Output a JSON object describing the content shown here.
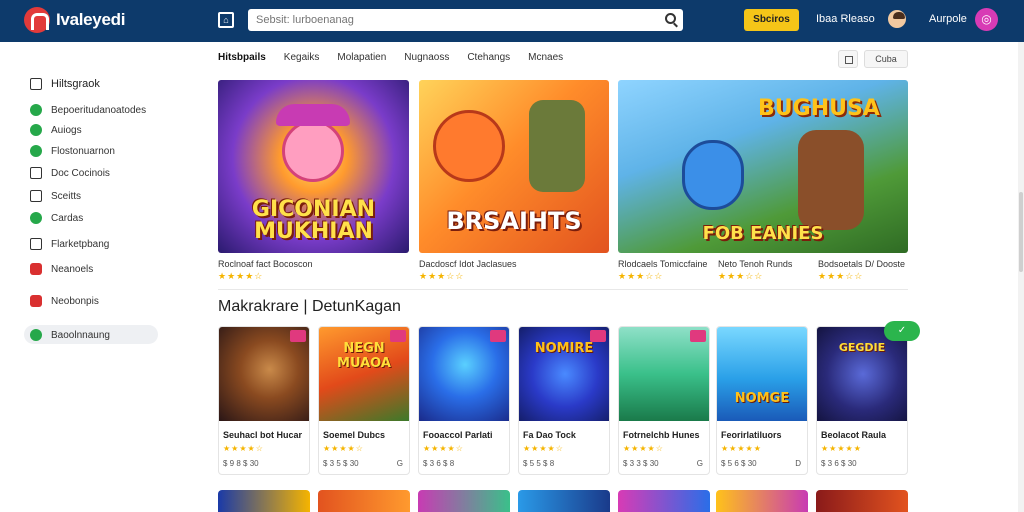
{
  "header": {
    "logo_text": "Ivaleyedi",
    "search_placeholder": "Sebsit: lurboenanag",
    "cta_label": "Sbciros",
    "link_label": "Ibaa Rleaso",
    "user_label": "Aurpole"
  },
  "sidebar": {
    "heading": "Hiltsgraok",
    "items": [
      {
        "label": "Bepoeritudanoatodes",
        "icon": "green-dot-icon"
      },
      {
        "label": "Auiogs",
        "icon": "green-dot-icon"
      },
      {
        "label": "Flostonuarnon",
        "icon": "green-dot-icon"
      },
      {
        "label": "Doc Cocinois",
        "icon": "outline-square-icon"
      },
      {
        "label": "Sceitts",
        "icon": "outline-square-icon"
      },
      {
        "label": "Cardas",
        "icon": "green-dot-icon"
      },
      {
        "label": "Flarketpbang",
        "icon": "outline-square-icon"
      },
      {
        "label": "Neanoels",
        "icon": "red-square-icon"
      },
      {
        "label": "Neobonpis",
        "icon": "red-square-icon"
      },
      {
        "label": "Baoolnnaung",
        "icon": "green-dot-icon"
      }
    ]
  },
  "tabs": [
    "Hitsbpails",
    "Kegaiks",
    "Molapatien",
    "Nugnaoss",
    "Ctehangs",
    "Mcnaes"
  ],
  "sort_label": "Cuba",
  "featured": [
    {
      "title_line1": "GICONIAN",
      "title_line2": "MUKHIAN",
      "meta": "Roclnoaf fact Bocoscon",
      "stars": "★★★★☆"
    },
    {
      "title_line1": "BRSAIHTS",
      "title_line2": "",
      "meta": "Dacdoscf Idot Jaclasues",
      "stars": "★★★☆☆"
    },
    {
      "title_line1": "BUGHUSA",
      "title_line2": "FOB EANIES",
      "meta": "Rlodcaels Tomiccfaine",
      "stars": "★★★☆☆"
    }
  ],
  "featured_extra": [
    {
      "meta": "Neto Tenoh Runds",
      "stars": "★★★☆☆"
    },
    {
      "meta": "Bodsoetals D/ Dooste",
      "stars": "★★★☆☆"
    }
  ],
  "section_title": "Makrakrare | DetunKagan",
  "tiles": [
    {
      "name": "Seuhacl bot Hucar",
      "stars": "★★★★☆",
      "price": "$ 9 8 $ 30",
      "icon": ""
    },
    {
      "name": "Soemel Dubcs",
      "stars": "★★★★☆",
      "price": "$ 3 5 $ 30",
      "icon": "G"
    },
    {
      "name": "Fooaccol Parlati",
      "stars": "★★★★☆",
      "price": "$ 3 6 $ 8",
      "icon": ""
    },
    {
      "name": "Fa Dao Tock",
      "stars": "★★★★☆",
      "price": "$ 5 5 $ 8",
      "icon": ""
    },
    {
      "name": "Fotrnelchb Hunes",
      "stars": "★★★★☆",
      "price": "$ 3 3 $ 30",
      "icon": "G"
    },
    {
      "name": "Feorirlatiluors",
      "stars": "★★★★★",
      "price": "$ 5 6 $ 30",
      "icon": "D"
    },
    {
      "name": "Beolacot Raula",
      "stars": "★★★★★",
      "price": "$ 3 6 $ 30",
      "icon": ""
    }
  ],
  "tile_words": [
    "",
    "NEGN MUAOA",
    "",
    "NOMIRE",
    "",
    "NOMGE",
    "GEGDIE"
  ],
  "colors": {
    "header_bg": "#0d3a6b",
    "accent_yellow": "#f5c518",
    "accent_green": "#2bb54d",
    "badge_pink": "#e0397e"
  }
}
